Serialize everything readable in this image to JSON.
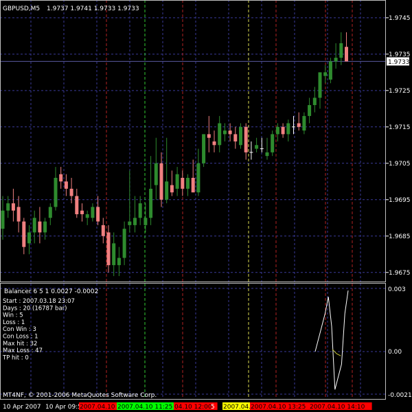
{
  "colors": {
    "background": "#000000",
    "grid": "#3a3a9a",
    "axis": "#ffffff",
    "bull": "#2e8b2e",
    "bear": "#f08080",
    "doji": "#ffffff",
    "bid_line": "#5a5aa0",
    "vline_red": "#b22222",
    "vline_green": "#32cd32",
    "vline_yellow": "#dcdc50",
    "indicator_line": "#ffffff",
    "indicator_cross": "#c8c832",
    "text": "#ffffff",
    "tag_red": "#ff0000",
    "tag_green": "#00ff00",
    "tag_yellow": "#ffff00"
  },
  "header": {
    "symbol_tf": "GBPUSD,M5",
    "ohlc": "1.9737 1.9741 1.9733 1.9733"
  },
  "price_axis": {
    "labels": [
      "1.9745",
      "1.9735",
      "1.9725",
      "1.9715",
      "1.9705",
      "1.9695",
      "1.9685",
      "1.9675"
    ],
    "current": "1.9733"
  },
  "indicator": {
    "title": "Balancer 6 5 1 0.0027 -0.0002",
    "stats": [
      "Start    : 2007.03.18 23:07",
      "Days     : 20 (16787 bar)",
      "Win      : 5",
      "Loss     : 1",
      "Con Win  : 3",
      "Con Loss : 1",
      "Max hit  : 32",
      "Max Loss : 47",
      "TP hit   : 0"
    ],
    "axis_labels": [
      "0.003",
      "0.00",
      "-0.0021"
    ],
    "footer": "MT4NF, © 2001-2006 MetaQuotes Software Corp."
  },
  "time_axis": {
    "labels": [
      "10 Apr 2007",
      "10 Apr 09:5"
    ],
    "tags": [
      {
        "text": "2007.04.10",
        "color": "red"
      },
      {
        "text": "2007.04.10 11:25",
        "color": "green"
      },
      {
        "text": "04.10 12:00",
        "color": "red"
      },
      {
        "text": "5",
        "color": "none"
      },
      {
        "text": "2007.04.",
        "color": "yellow"
      },
      {
        "text": "2007.04.10 13:25",
        "color": "red"
      },
      {
        "text": "2007.04.10 14:10",
        "color": "red"
      }
    ]
  },
  "chart_data": {
    "type": "candlestick",
    "ylim": [
      1.96725,
      1.97495
    ],
    "candles": [
      [
        1.9687,
        1.9696,
        1.9684,
        1.9692
      ],
      [
        1.9692,
        1.9696,
        1.969,
        1.9694
      ],
      [
        1.9694,
        1.9698,
        1.9689,
        1.9692
      ],
      [
        1.9693,
        1.9696,
        1.9686,
        1.9689
      ],
      [
        1.9689,
        1.969,
        1.968,
        1.9682
      ],
      [
        1.9683,
        1.9688,
        1.968,
        1.9686
      ],
      [
        1.9686,
        1.9692,
        1.9683,
        1.969
      ],
      [
        1.9689,
        1.9693,
        1.9683,
        1.9686
      ],
      [
        1.9686,
        1.969,
        1.9684,
        1.9689
      ],
      [
        1.969,
        1.9694,
        1.9688,
        1.9693
      ],
      [
        1.9693,
        1.9704,
        1.9692,
        1.9701
      ],
      [
        1.9702,
        1.9704,
        1.9698,
        1.97
      ],
      [
        1.97,
        1.9702,
        1.9696,
        1.9698
      ],
      [
        1.9698,
        1.9701,
        1.9694,
        1.9696
      ],
      [
        1.9696,
        1.9698,
        1.969,
        1.9691
      ],
      [
        1.9692,
        1.9694,
        1.9689,
        1.9691
      ],
      [
        1.969,
        1.9692,
        1.9688,
        1.9691
      ],
      [
        1.969,
        1.9694,
        1.9689,
        1.9693
      ],
      [
        1.9693,
        1.9696,
        1.9688,
        1.9689
      ],
      [
        1.9688,
        1.969,
        1.9683,
        1.9685
      ],
      [
        1.9686,
        1.9688,
        1.9675,
        1.9677
      ],
      [
        1.9677,
        1.9686,
        1.9674,
        1.9683
      ],
      [
        1.9677,
        1.9682,
        1.9674,
        1.9679
      ],
      [
        1.9679,
        1.9689,
        1.9677,
        1.9687
      ],
      [
        1.9688,
        1.9703,
        1.9686,
        1.9689
      ],
      [
        1.9688,
        1.9696,
        1.9686,
        1.969
      ],
      [
        1.969,
        1.9696,
        1.9688,
        1.9694
      ],
      [
        1.9688,
        1.9694,
        1.9686,
        1.969
      ],
      [
        1.969,
        1.9707,
        1.9688,
        1.9698
      ],
      [
        1.9699,
        1.9712,
        1.9695,
        1.9705
      ],
      [
        1.9705,
        1.9708,
        1.9693,
        1.9695
      ],
      [
        1.9695,
        1.9712,
        1.9694,
        1.97
      ],
      [
        1.9699,
        1.9703,
        1.9696,
        1.9697
      ],
      [
        1.9698,
        1.9704,
        1.9696,
        1.9702
      ],
      [
        1.9701,
        1.9703,
        1.9696,
        1.9698
      ],
      [
        1.9698,
        1.9702,
        1.9696,
        1.9701
      ],
      [
        1.9701,
        1.9706,
        1.9697,
        1.9697
      ],
      [
        1.9697,
        1.9709,
        1.9696,
        1.9705
      ],
      [
        1.9705,
        1.9713,
        1.9704,
        1.9713
      ],
      [
        1.9713,
        1.9718,
        1.9708,
        1.9712
      ],
      [
        1.9711,
        1.9714,
        1.9708,
        1.971
      ],
      [
        1.971,
        1.9718,
        1.9708,
        1.9716
      ],
      [
        1.9713,
        1.9716,
        1.9711,
        1.9714
      ],
      [
        1.9714,
        1.9716,
        1.9711,
        1.9713
      ],
      [
        1.9713,
        1.9715,
        1.9709,
        1.9711
      ],
      [
        1.971,
        1.9716,
        1.9709,
        1.9715
      ],
      [
        1.9715,
        1.9716,
        1.9706,
        1.9708
      ],
      [
        1.9708,
        1.9711,
        1.9706,
        1.9708
      ],
      [
        1.9709,
        1.9712,
        1.9708,
        1.971
      ],
      [
        1.9709,
        1.9712,
        1.9708,
        1.9709
      ],
      [
        1.9707,
        1.9712,
        1.9706,
        1.9708
      ],
      [
        1.9708,
        1.9714,
        1.9707,
        1.9713
      ],
      [
        1.9713,
        1.9716,
        1.9711,
        1.9715
      ],
      [
        1.9715,
        1.9716,
        1.9712,
        1.9713
      ],
      [
        1.9713,
        1.9717,
        1.9711,
        1.9716
      ],
      [
        1.9715,
        1.9718,
        1.9713,
        1.9715
      ],
      [
        1.9716,
        1.9719,
        1.9714,
        1.9715
      ],
      [
        1.9714,
        1.9719,
        1.9713,
        1.9718
      ],
      [
        1.9718,
        1.9723,
        1.9716,
        1.9721
      ],
      [
        1.9721,
        1.9726,
        1.9719,
        1.9723
      ],
      [
        1.9723,
        1.973,
        1.972,
        1.973
      ],
      [
        1.9729,
        1.9732,
        1.9727,
        1.973
      ],
      [
        1.9728,
        1.9734,
        1.9727,
        1.9733
      ],
      [
        1.9733,
        1.9738,
        1.9731,
        1.9734
      ],
      [
        1.9734,
        1.9741,
        1.9732,
        1.9738
      ],
      [
        1.9737,
        1.9741,
        1.9733,
        1.9733
      ]
    ],
    "indicator_series": [
      [
        0.0,
        0.0
      ],
      [
        0.8,
        0.0006
      ],
      [
        1.6,
        0.0012
      ],
      [
        2.4,
        0.0018
      ],
      [
        3.2,
        0.0026
      ],
      [
        4.0,
        0.0012
      ],
      [
        4.8,
        -0.0018
      ],
      [
        5.6,
        -0.0012
      ],
      [
        6.4,
        -0.0006
      ],
      [
        7.2,
        0.0018
      ],
      [
        8.0,
        0.0029
      ]
    ],
    "indicator_secondary": [
      [
        4.2,
        0.0001
      ],
      [
        5.2,
        -0.0001
      ],
      [
        6.2,
        -0.0002
      ]
    ]
  }
}
